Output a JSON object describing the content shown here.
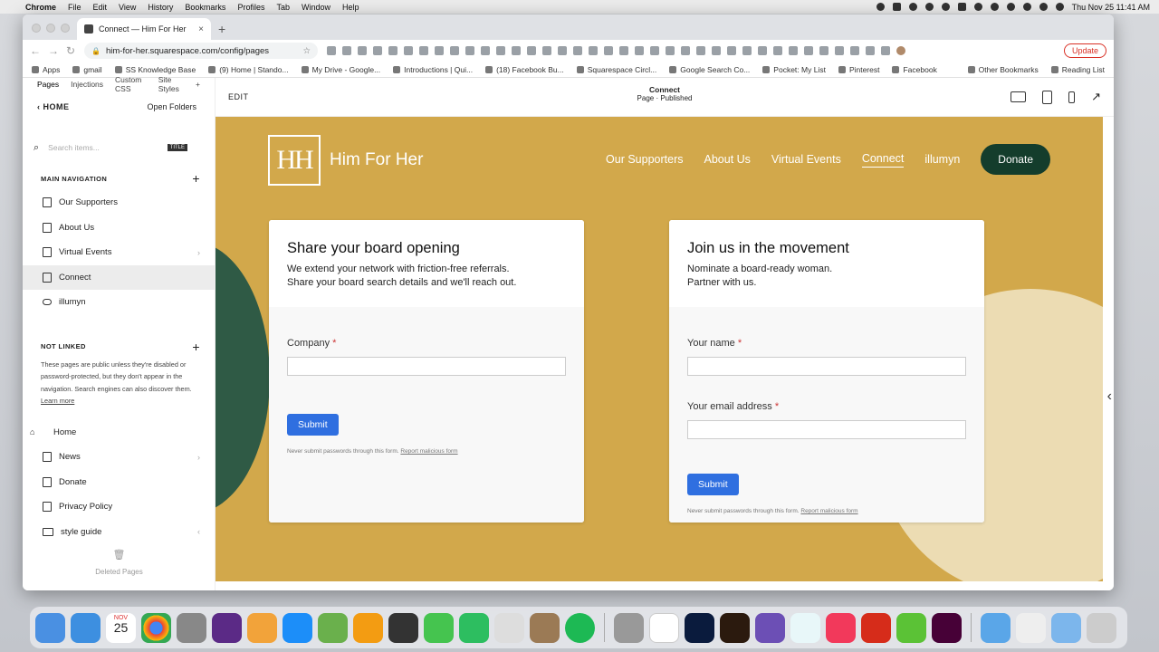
{
  "menubar": {
    "app": "Chrome",
    "items": [
      "File",
      "Edit",
      "View",
      "History",
      "Bookmarks",
      "Profiles",
      "Tab",
      "Window",
      "Help"
    ],
    "datetime": "Thu Nov 25  11:41 AM"
  },
  "browser": {
    "tab_title": "Connect — Him For Her",
    "url": "him-for-her.squarespace.com/config/pages",
    "update_label": "Update",
    "bookmarks": [
      "Apps",
      "gmail",
      "SS Knowledge Base",
      "(9) Home | Stando...",
      "My Drive - Google...",
      "Introductions | Qui...",
      "(18) Facebook Bu...",
      "Squarespace Circl...",
      "Google Search Co...",
      "Pocket: My List",
      "Pinterest",
      "Facebook"
    ],
    "bookmarks_right": [
      "Other Bookmarks",
      "Reading List"
    ]
  },
  "sidebar": {
    "tabs": [
      "Pages",
      "Injections",
      "Custom CSS",
      "Site Styles"
    ],
    "back_label": "HOME",
    "open_folders": "Open Folders",
    "search_placeholder": "Search items...",
    "search_badge": "TITLE",
    "main_nav_title": "MAIN NAVIGATION",
    "main_nav": [
      {
        "label": "Our Supporters",
        "icon": "page-icon"
      },
      {
        "label": "About Us",
        "icon": "page-icon"
      },
      {
        "label": "Virtual Events",
        "icon": "collection-icon"
      },
      {
        "label": "Connect",
        "icon": "page-icon"
      },
      {
        "label": "illumyn",
        "icon": "link-icon"
      }
    ],
    "not_linked_title": "NOT LINKED",
    "not_linked_note": "These pages are public unless they're disabled or password-protected, but they don't appear in the navigation. Search engines can also discover them.",
    "learn_more": "Learn more",
    "not_linked": [
      {
        "label": "Home",
        "icon": "home-icon"
      },
      {
        "label": "News",
        "icon": "blog-icon"
      },
      {
        "label": "Donate",
        "icon": "page-icon"
      },
      {
        "label": "Privacy Policy",
        "icon": "page-icon"
      },
      {
        "label": "style guide",
        "icon": "folder-icon"
      }
    ],
    "deleted_pages": "Deleted Pages"
  },
  "editor": {
    "edit_label": "EDIT",
    "page_title": "Connect",
    "page_status": "Page · Published"
  },
  "site": {
    "brand": "Him For Her",
    "nav": [
      "Our Supporters",
      "About Us",
      "Virtual Events",
      "Connect",
      "illumyn"
    ],
    "donate": "Donate",
    "card1": {
      "heading": "Share your board opening",
      "line1": "We extend your network with friction-free referrals.",
      "line2": "Share your board search details and we'll reach out.",
      "field1": "Company",
      "submit": "Submit",
      "disclaimer": "Never submit passwords through this form.",
      "report": "Report malicious form"
    },
    "card2": {
      "heading": "Join us in the movement",
      "line1": "Nominate a board-ready woman.",
      "line2": "Partner with us.",
      "field1": "Your name",
      "field2": "Your email address",
      "submit": "Submit",
      "disclaimer": "Never submit passwords through this form.",
      "report": "Report malicious form"
    },
    "required_mark": "*"
  },
  "dock": {
    "calendar_month": "NOV",
    "calendar_day": "25"
  },
  "colors": {
    "site_bg": "#d2a84b",
    "donate_bg": "#143d2c",
    "submit_bg": "#2f6fe0"
  }
}
